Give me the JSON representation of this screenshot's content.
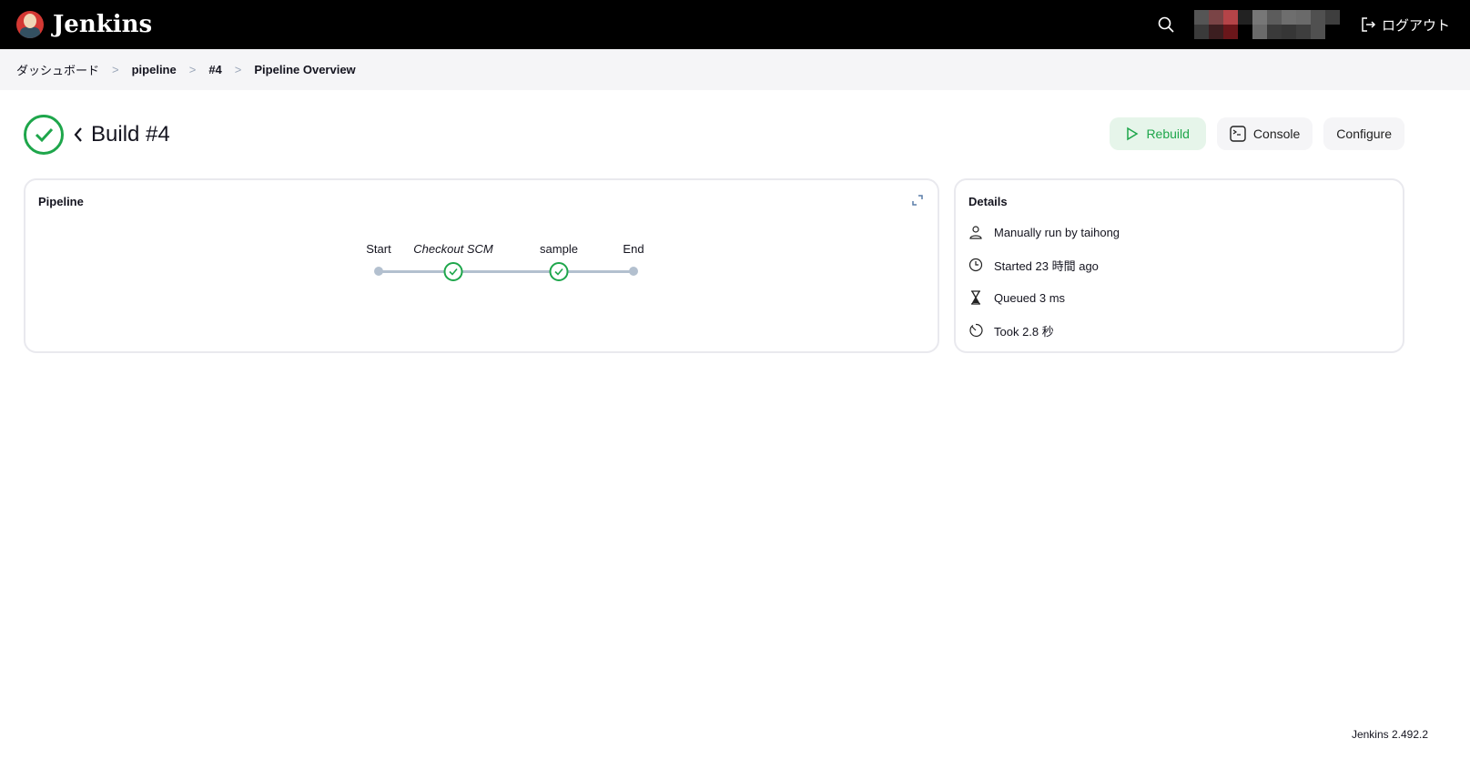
{
  "header": {
    "brand": "Jenkins",
    "logout": "ログアウト"
  },
  "breadcrumb": [
    "ダッシュボード",
    "pipeline",
    "#4",
    "Pipeline Overview"
  ],
  "build": {
    "title": "Build #4",
    "status": "success"
  },
  "actions": {
    "rebuild": "Rebuild",
    "console": "Console",
    "configure": "Configure"
  },
  "pipeline": {
    "title": "Pipeline",
    "stages": [
      "Start",
      "Checkout SCM",
      "sample",
      "End"
    ]
  },
  "details": {
    "title": "Details",
    "run_by": "Manually run by taihong",
    "started": "Started 23 時間 ago",
    "queued": "Queued 3 ms",
    "took": "Took 2.8 秒"
  },
  "footer": {
    "version": "Jenkins 2.492.2"
  },
  "colors": {
    "success": "#1ea64b",
    "header": "#000000"
  }
}
